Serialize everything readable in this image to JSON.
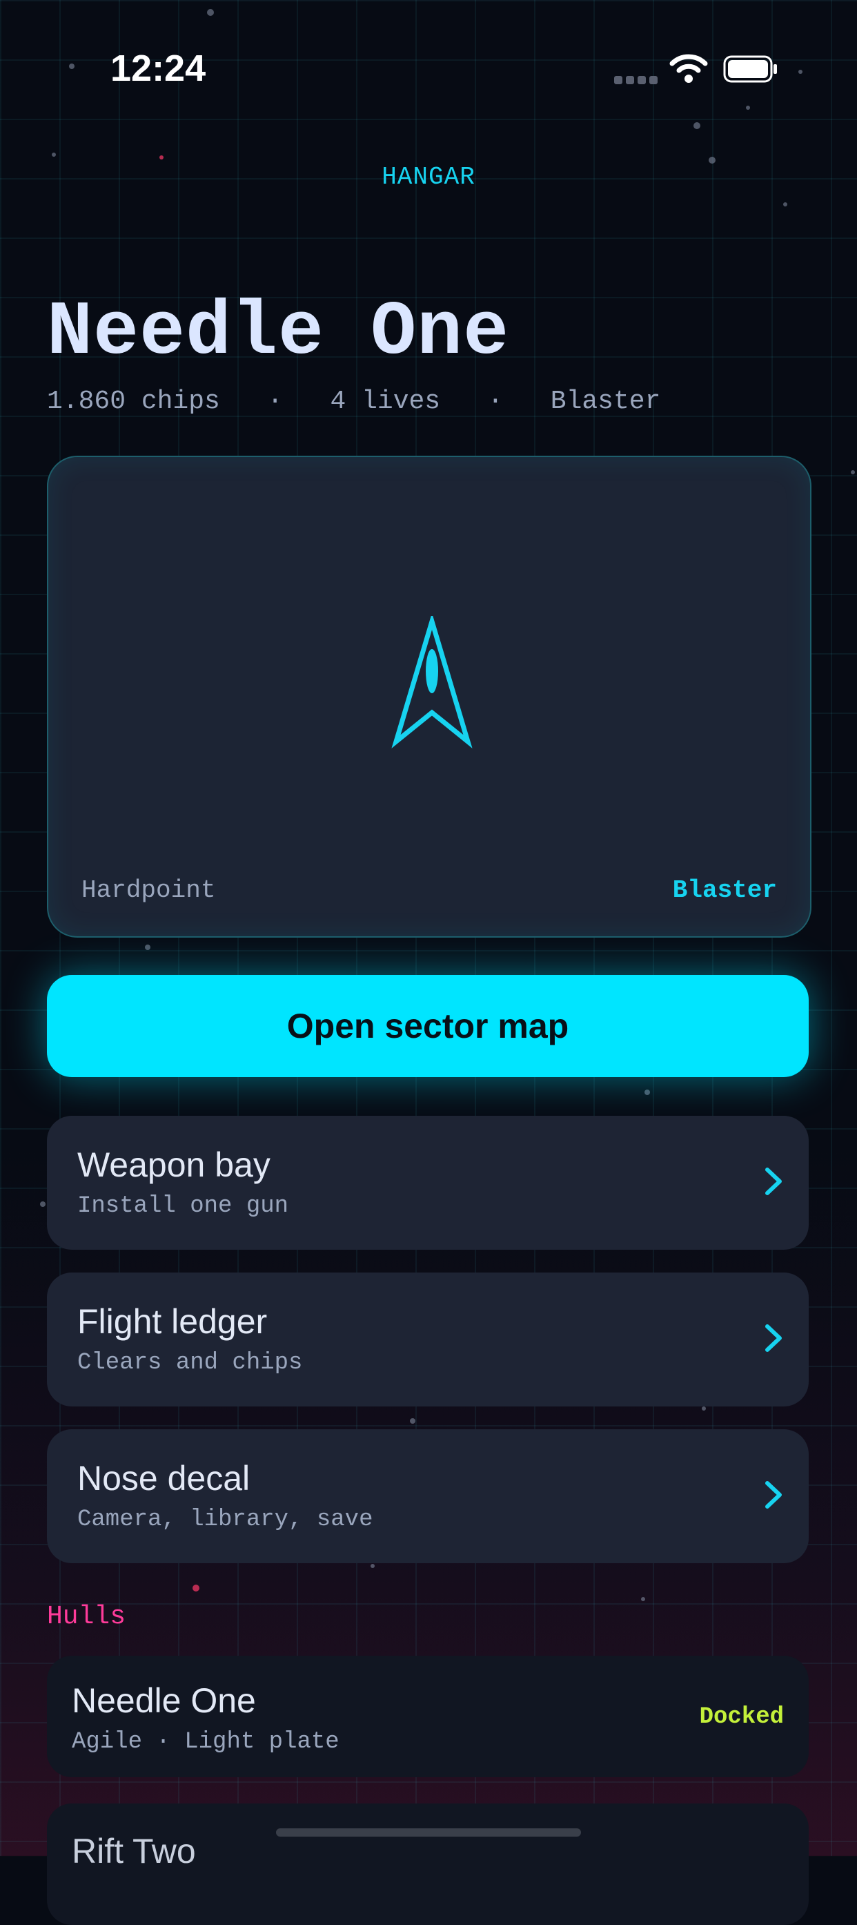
{
  "status_bar": {
    "time": "12:24"
  },
  "nav": {
    "title": "HANGAR"
  },
  "hero": {
    "name": "Needle One",
    "chips": "1.860 chips",
    "lives": "4 lives",
    "weapon": "Blaster"
  },
  "ship_card": {
    "hardpoint_label": "Hardpoint",
    "hardpoint_value": "Blaster",
    "ship_icon": "arrowhead-ship-icon",
    "accent": "#17d3f0"
  },
  "cta": {
    "label": "Open sector map",
    "color": "#00e5ff"
  },
  "menu": [
    {
      "title": "Weapon bay",
      "subtitle": "Install one gun"
    },
    {
      "title": "Flight ledger",
      "subtitle": "Clears and chips"
    },
    {
      "title": "Nose decal",
      "subtitle": "Camera, library, save"
    }
  ],
  "hulls": {
    "label": "Hulls",
    "items": [
      {
        "name": "Needle One",
        "trait": "Agile",
        "armor": "Light plate",
        "status": "Docked"
      },
      {
        "name": "Rift Two",
        "trait": "",
        "armor": "",
        "status": ""
      }
    ]
  }
}
